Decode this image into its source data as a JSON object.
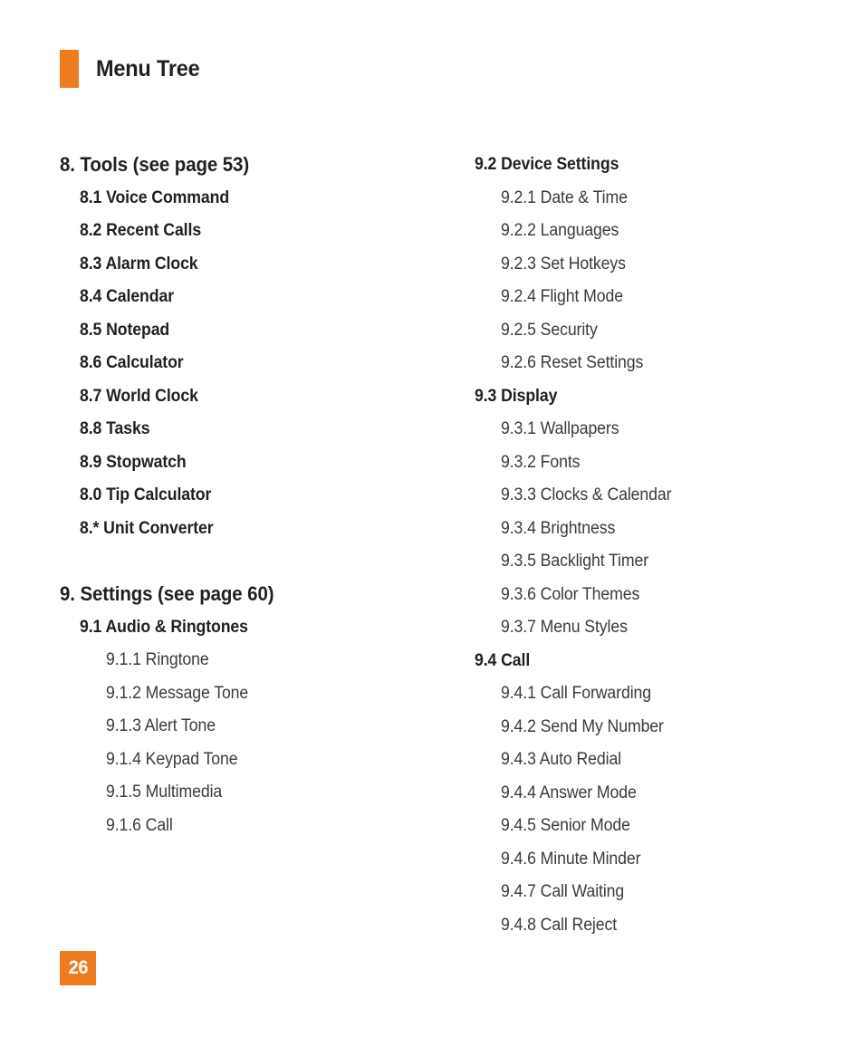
{
  "header": {
    "title": "Menu Tree",
    "accent_color": "#f07c22"
  },
  "footer": {
    "page_number": "26",
    "badge_color": "#f07c22",
    "badge_text_color": "#ffffff"
  },
  "colors": {
    "accent_orange": "#f07c22",
    "heading_text": "#231f20",
    "subitem_text": "#3c3a3b",
    "page_background": "#ffffff"
  },
  "columns": [
    {
      "name": "left-column",
      "entries": [
        {
          "level": 1,
          "label": "8. Tools (see page 53)",
          "gap_before": false
        },
        {
          "level": 2,
          "label": "8.1 Voice Command",
          "gap_before": false
        },
        {
          "level": 2,
          "label": "8.2 Recent Calls",
          "gap_before": false
        },
        {
          "level": 2,
          "label": "8.3 Alarm Clock",
          "gap_before": false
        },
        {
          "level": 2,
          "label": "8.4 Calendar",
          "gap_before": false
        },
        {
          "level": 2,
          "label": "8.5 Notepad",
          "gap_before": false
        },
        {
          "level": 2,
          "label": "8.6 Calculator",
          "gap_before": false
        },
        {
          "level": 2,
          "label": "8.7 World Clock",
          "gap_before": false
        },
        {
          "level": 2,
          "label": "8.8 Tasks",
          "gap_before": false
        },
        {
          "level": 2,
          "label": "8.9 Stopwatch",
          "gap_before": false
        },
        {
          "level": 2,
          "label": "8.0 Tip Calculator",
          "gap_before": false
        },
        {
          "level": 2,
          "label": "8.* Unit Converter",
          "gap_before": false
        },
        {
          "level": 1,
          "label": "9. Settings (see page 60)",
          "gap_before": true
        },
        {
          "level": 2,
          "label": "9.1 Audio & Ringtones",
          "gap_before": false
        },
        {
          "level": 3,
          "label": "9.1.1 Ringtone",
          "gap_before": false
        },
        {
          "level": 3,
          "label": "9.1.2 Message Tone",
          "gap_before": false
        },
        {
          "level": 3,
          "label": "9.1.3 Alert Tone",
          "gap_before": false
        },
        {
          "level": 3,
          "label": "9.1.4 Keypad Tone",
          "gap_before": false
        },
        {
          "level": 3,
          "label": "9.1.5 Multimedia",
          "gap_before": false
        },
        {
          "level": 3,
          "label": "9.1.6 Call",
          "gap_before": false
        }
      ]
    },
    {
      "name": "right-column",
      "entries": [
        {
          "level": 2,
          "label": "9.2 Device Settings",
          "gap_before": false
        },
        {
          "level": 3,
          "label": "9.2.1 Date & Time",
          "gap_before": false
        },
        {
          "level": 3,
          "label": "9.2.2 Languages",
          "gap_before": false
        },
        {
          "level": 3,
          "label": "9.2.3 Set Hotkeys",
          "gap_before": false
        },
        {
          "level": 3,
          "label": "9.2.4 Flight Mode",
          "gap_before": false
        },
        {
          "level": 3,
          "label": "9.2.5 Security",
          "gap_before": false
        },
        {
          "level": 3,
          "label": "9.2.6 Reset Settings",
          "gap_before": false
        },
        {
          "level": 2,
          "label": "9.3 Display",
          "gap_before": false
        },
        {
          "level": 3,
          "label": "9.3.1 Wallpapers",
          "gap_before": false
        },
        {
          "level": 3,
          "label": "9.3.2 Fonts",
          "gap_before": false
        },
        {
          "level": 3,
          "label": "9.3.3 Clocks & Calendar",
          "gap_before": false
        },
        {
          "level": 3,
          "label": "9.3.4 Brightness",
          "gap_before": false
        },
        {
          "level": 3,
          "label": "9.3.5 Backlight Timer",
          "gap_before": false
        },
        {
          "level": 3,
          "label": "9.3.6 Color Themes",
          "gap_before": false
        },
        {
          "level": 3,
          "label": "9.3.7 Menu Styles",
          "gap_before": false
        },
        {
          "level": 2,
          "label": "9.4 Call",
          "gap_before": false
        },
        {
          "level": 3,
          "label": "9.4.1 Call Forwarding",
          "gap_before": false
        },
        {
          "level": 3,
          "label": "9.4.2 Send My Number",
          "gap_before": false
        },
        {
          "level": 3,
          "label": "9.4.3 Auto Redial",
          "gap_before": false
        },
        {
          "level": 3,
          "label": "9.4.4 Answer Mode",
          "gap_before": false
        },
        {
          "level": 3,
          "label": "9.4.5 Senior Mode",
          "gap_before": false
        },
        {
          "level": 3,
          "label": "9.4.6 Minute Minder",
          "gap_before": false
        },
        {
          "level": 3,
          "label": "9.4.7 Call Waiting",
          "gap_before": false
        },
        {
          "level": 3,
          "label": "9.4.8 Call Reject",
          "gap_before": false
        }
      ]
    }
  ]
}
